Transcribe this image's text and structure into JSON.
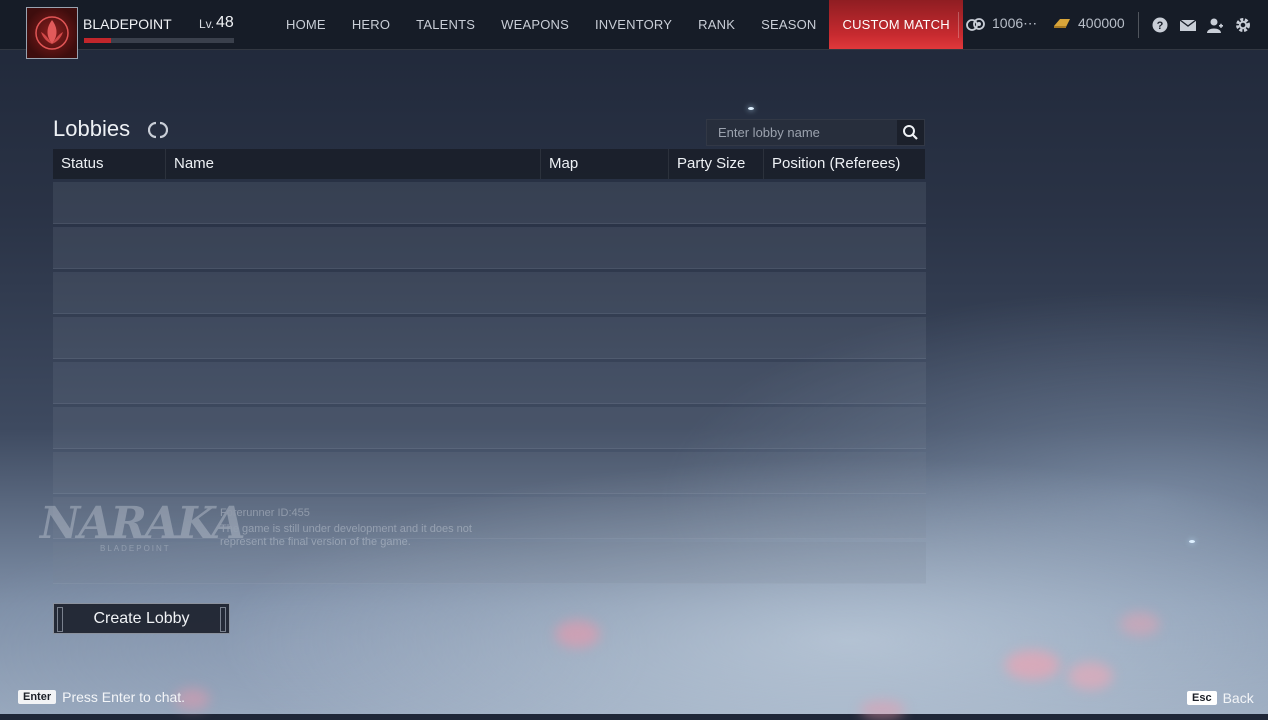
{
  "player": {
    "name": "BLADEPOINT",
    "level_prefix": "Lv.",
    "level": "48",
    "xp_fraction": 0.18
  },
  "nav": {
    "items": [
      {
        "label": "HOME",
        "active": false
      },
      {
        "label": "HERO",
        "active": false
      },
      {
        "label": "TALENTS",
        "active": false
      },
      {
        "label": "WEAPONS",
        "active": false
      },
      {
        "label": "INVENTORY",
        "active": false
      },
      {
        "label": "RANK",
        "active": false
      },
      {
        "label": "SEASON",
        "active": false
      },
      {
        "label": "CUSTOM MATCH",
        "active": true
      }
    ]
  },
  "currency": {
    "coins": "1006⋯",
    "gold": "400000"
  },
  "top_icons": [
    "help-icon",
    "mail-icon",
    "friends-icon",
    "settings-icon"
  ],
  "lobbies": {
    "title": "Lobbies",
    "search_placeholder": "Enter lobby name",
    "columns": [
      "Status",
      "Name",
      "Map",
      "Party Size",
      "Position (Referees)"
    ],
    "rows": [
      [
        "",
        "",
        "",
        "",
        ""
      ],
      [
        "",
        "",
        "",
        "",
        ""
      ],
      [
        "",
        "",
        "",
        "",
        ""
      ],
      [
        "",
        "",
        "",
        "",
        ""
      ],
      [
        "",
        "",
        "",
        "",
        ""
      ],
      [
        "",
        "",
        "",
        "",
        ""
      ],
      [
        "",
        "",
        "",
        "",
        ""
      ],
      [
        "",
        "",
        "",
        "",
        ""
      ],
      [
        "",
        "",
        "",
        "",
        ""
      ]
    ],
    "create_label": "Create Lobby"
  },
  "watermark": {
    "logo": "NARAKA",
    "subtitle": "BLADEPOINT",
    "forerunner_id": "Forerunner ID:455",
    "note": "The game is still under development and it does not represent the final version of the game."
  },
  "footer": {
    "chat_key": "Enter",
    "chat_text": "Press Enter to chat.",
    "back_key": "Esc",
    "back_text": "Back"
  },
  "colors": {
    "accent": "#c62a2f",
    "topbar": "#161b26"
  }
}
